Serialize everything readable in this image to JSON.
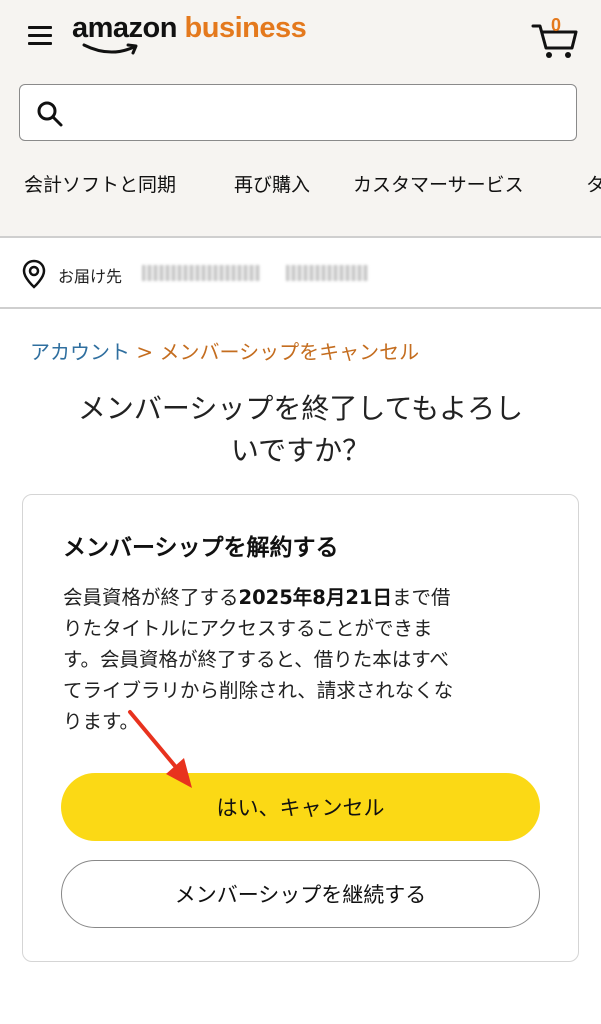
{
  "header": {
    "logo_primary": "amazon",
    "logo_secondary": "business",
    "cart_count": "0",
    "search": {
      "placeholder": ""
    },
    "nav_items": [
      "会計ソフトと同期",
      "再び購入",
      "カスタマーサービス",
      "タ"
    ]
  },
  "delivery": {
    "label": "お届け先"
  },
  "breadcrumb": {
    "parent": "アカウント",
    "separator": ">",
    "current": "メンバーシップをキャンセル"
  },
  "page": {
    "title_line1": "メンバーシップを終了してもよろし",
    "title_line2": "いですか？"
  },
  "card": {
    "title": "メンバーシップを解約する",
    "body_line1_pre": "会員資格が終了する",
    "body_line1_date": "2025年8月21日",
    "body_line1_post": "まで借",
    "body_line2": "りたタイトルにアクセスすることができま",
    "body_line3": "す。会員資格が終了すると、借りた本はすべ",
    "body_line4": "てライブラリから削除され、請求されなくな",
    "body_line5": "ります。",
    "yes_button": "はい、キャンセル",
    "continue_button": "メンバーシップを継続する"
  },
  "colors": {
    "accent_orange": "#e4791d",
    "button_yellow": "#fbd915",
    "link_blue": "#2f6f9f",
    "arrow_red": "#e8321e"
  }
}
